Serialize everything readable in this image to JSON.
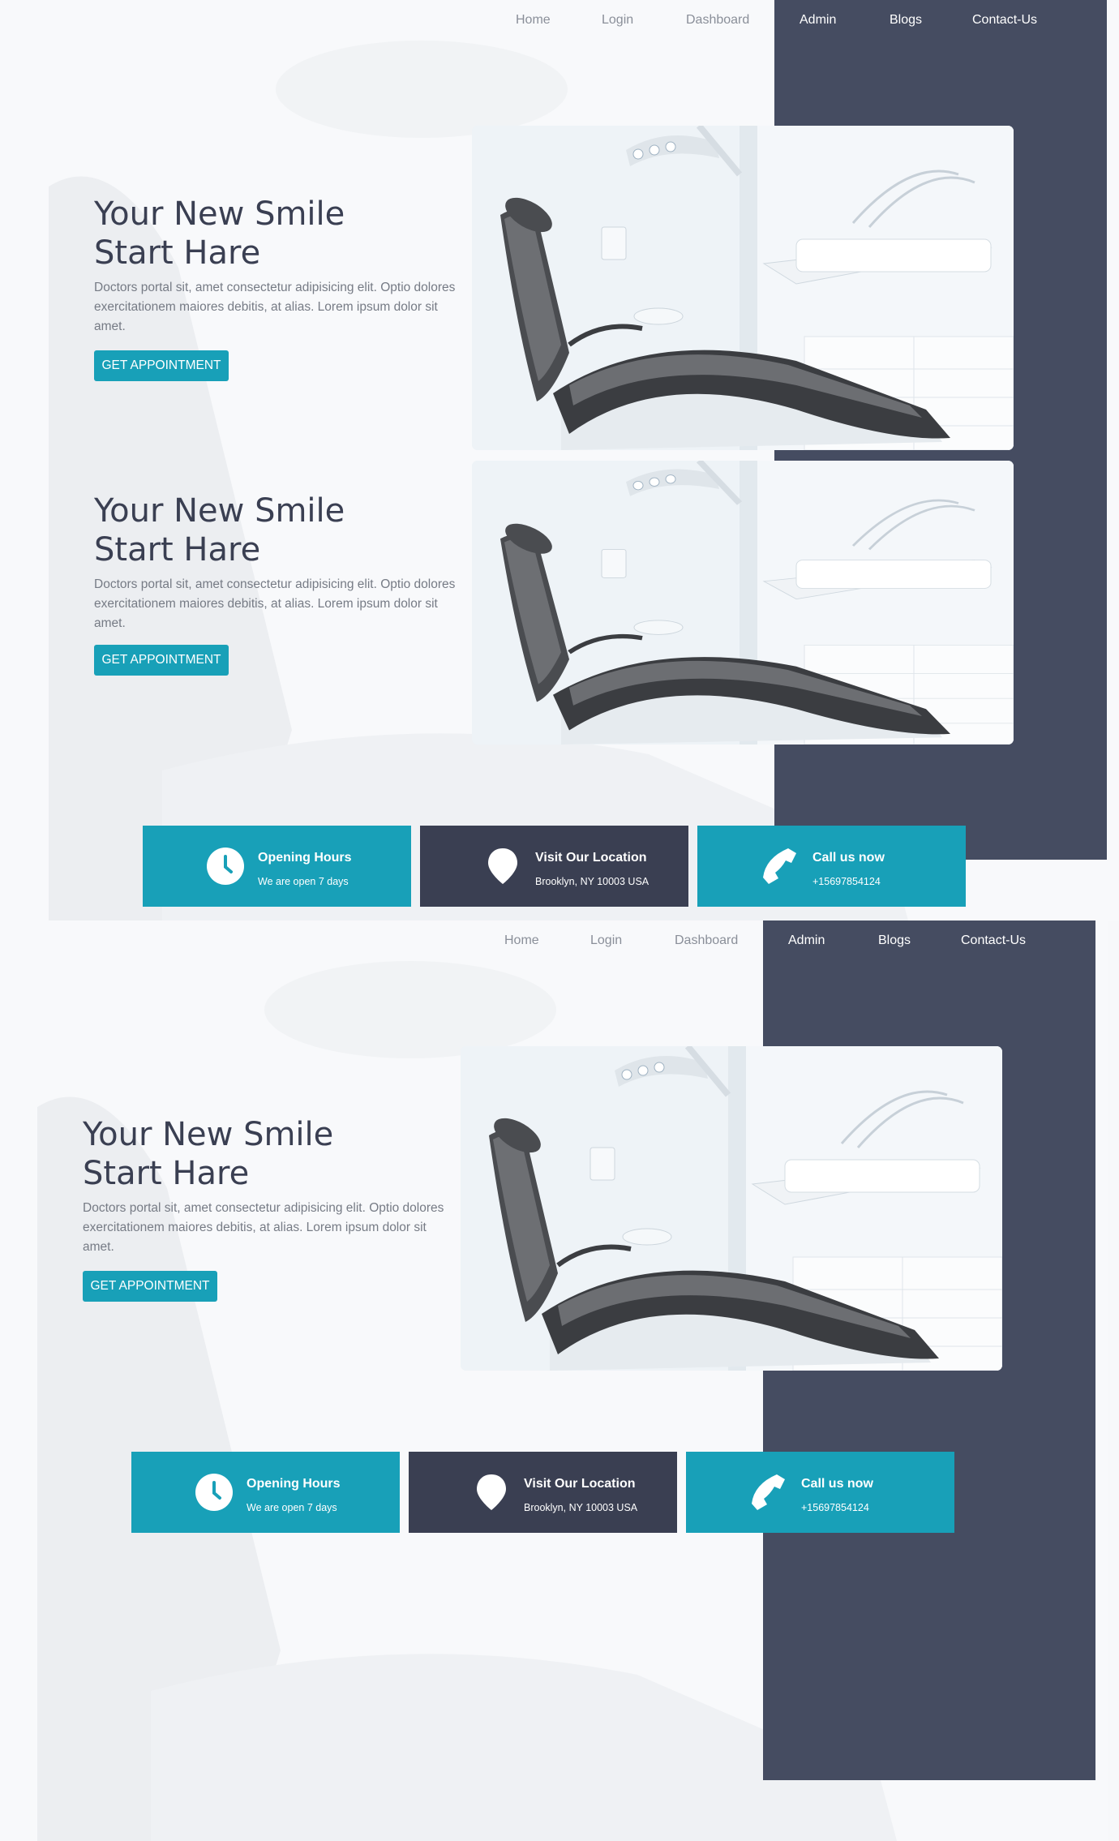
{
  "colors": {
    "accent": "#18a0b8",
    "dark": "#3a3f52",
    "panel": "#454c61",
    "text": "#767b85"
  },
  "nav": {
    "items": [
      {
        "label": "Home"
      },
      {
        "label": "Login"
      },
      {
        "label": "Dashboard"
      },
      {
        "label": "Admin"
      },
      {
        "label": "Blogs"
      },
      {
        "label": "Contact-Us"
      }
    ]
  },
  "hero": {
    "title_line1": "Your New Smile",
    "title_line2": "Start Hare",
    "text": "Doctors portal sit, amet consectetur adipisicing elit. Optio dolores exercitationem maiores debitis, at alias. Lorem ipsum dolor sit amet.",
    "button": "GET APPOINTMENT",
    "image": "dental-chair-photo"
  },
  "cards": [
    {
      "title": "Opening Hours",
      "subtitle": "We are open 7 days",
      "icon": "clock-icon"
    },
    {
      "title": "Visit Our Location",
      "subtitle": "Brooklyn, NY 10003 USA",
      "icon": "location-pin-icon"
    },
    {
      "title": "Call us now",
      "subtitle": "+15697854124",
      "icon": "phone-icon"
    }
  ]
}
